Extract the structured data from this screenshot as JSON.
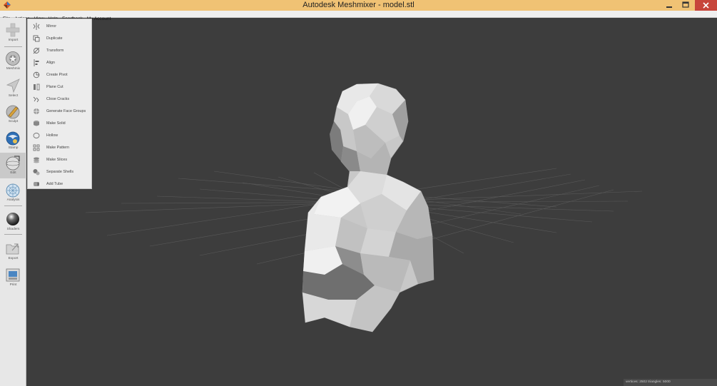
{
  "window": {
    "title": "Autodesk Meshmixer - model.stl",
    "icons": {
      "app": "meshmixer-logo-icon",
      "minimize": "minimize-icon",
      "maximize": "restore-icon",
      "close": "close-icon"
    }
  },
  "menubar": {
    "items": [
      "File",
      "Actions",
      "View",
      "Help",
      "Feedback",
      "My Account"
    ]
  },
  "toolbar": {
    "tools": [
      {
        "label": "Import",
        "icon": "import-plus-icon"
      },
      {
        "label": "Meshmix",
        "icon": "meshmix-icon"
      },
      {
        "label": "Select",
        "icon": "select-arrow-icon"
      },
      {
        "label": "Sculpt",
        "icon": "sculpt-brush-icon"
      },
      {
        "label": "Stamp",
        "icon": "stamp-icon"
      },
      {
        "label": "Edit",
        "icon": "edit-sphere-icon"
      },
      {
        "label": "Analysis",
        "icon": "analysis-icon"
      },
      {
        "label": "Shaders",
        "icon": "shaders-sphere-icon"
      },
      {
        "label": "Export",
        "icon": "export-folder-icon"
      },
      {
        "label": "Print",
        "icon": "print-icon"
      }
    ],
    "active": "Edit"
  },
  "edit_menu": {
    "items": [
      {
        "label": "Mirror",
        "icon": "mirror-icon"
      },
      {
        "label": "Duplicate",
        "icon": "duplicate-icon"
      },
      {
        "label": "Transform",
        "icon": "transform-icon"
      },
      {
        "label": "Align",
        "icon": "align-icon"
      },
      {
        "label": "Create Pivot",
        "icon": "pivot-icon"
      },
      {
        "label": "Plane Cut",
        "icon": "plane-cut-icon"
      },
      {
        "label": "Close Cracks",
        "icon": "close-cracks-icon"
      },
      {
        "label": "Generate Face Groups",
        "icon": "face-groups-icon"
      },
      {
        "label": "Make Solid",
        "icon": "make-solid-icon"
      },
      {
        "label": "Hollow",
        "icon": "hollow-icon"
      },
      {
        "label": "Make Pattern",
        "icon": "pattern-icon"
      },
      {
        "label": "Make Slices",
        "icon": "slices-icon"
      },
      {
        "label": "Separate Shells",
        "icon": "separate-shells-icon"
      },
      {
        "label": "Add Tube",
        "icon": "tube-icon"
      }
    ]
  },
  "viewport": {
    "model": "low-poly-bust-model",
    "grid": true
  },
  "status": {
    "text": "vertices: 2502 triangles: 5000"
  },
  "colors": {
    "titlebar": "#f0c274",
    "viewport_bg": "#3d3d3d",
    "close_button": "#c7453b",
    "model": "#cfcfcf"
  }
}
